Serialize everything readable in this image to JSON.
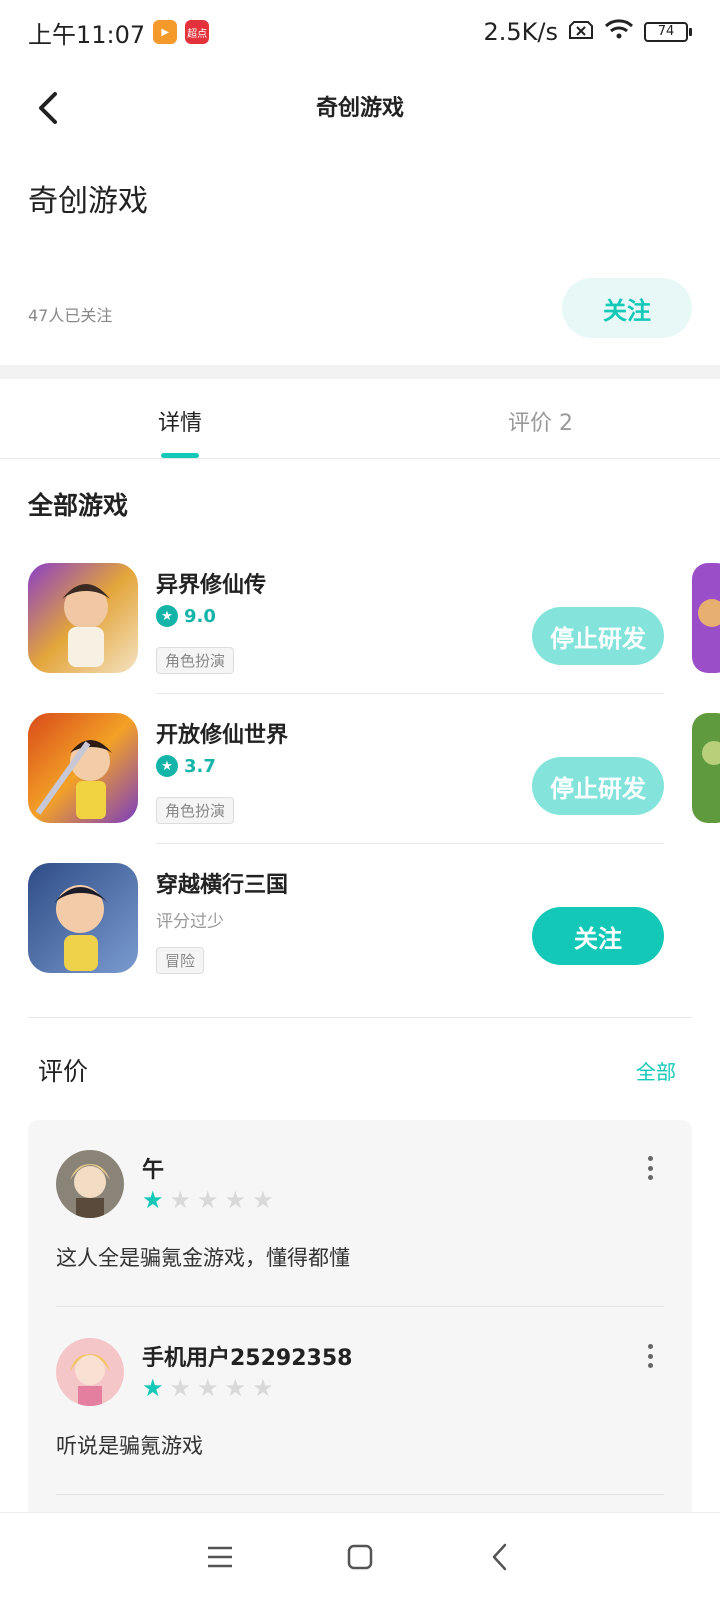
{
  "status_bar": {
    "time": "上午11:07",
    "app_badges": [
      "",
      "超点"
    ],
    "network_speed": "2.5K/s",
    "battery": "74"
  },
  "header": {
    "title": "奇创游戏"
  },
  "developer": {
    "name": "奇创游戏",
    "followers": "47人已关注",
    "follow_label": "关注"
  },
  "tabs": [
    {
      "label": "详情",
      "active": true
    },
    {
      "label": "评价 2",
      "active": false
    }
  ],
  "games_section": {
    "title": "全部游戏",
    "games": [
      {
        "name": "异界修仙传",
        "rating": "9.0",
        "tag": "角色扮演",
        "button": "停止研发"
      },
      {
        "name": "开放修仙世界",
        "rating": "3.7",
        "tag": "角色扮演",
        "button": "停止研发"
      },
      {
        "name": "穿越横行三国",
        "rating_text": "评分过少",
        "tag": "冒险",
        "button": "关注"
      }
    ]
  },
  "reviews_section": {
    "title": "评价",
    "all_label": "全部",
    "reviews": [
      {
        "user": "午",
        "stars": 1,
        "text": "这人全是骗氪金游戏，懂得都懂"
      },
      {
        "user": "手机用户25292358",
        "stars": 1,
        "text": "听说是骗氪游戏"
      }
    ]
  },
  "colors": {
    "accent": "#14c8b8",
    "accent_light": "#84e4db",
    "follow_bg": "#e7f8f7"
  }
}
